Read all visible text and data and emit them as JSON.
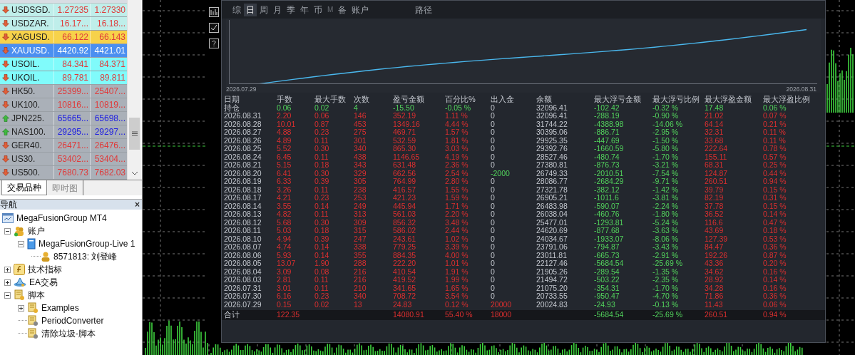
{
  "market_watch": {
    "rows": [
      {
        "symbol": "USDSGD.",
        "bid": "1.27235",
        "ask": "1.27330",
        "rising": false,
        "color": "#bfeeea",
        "selected": false
      },
      {
        "symbol": "USDZAR.",
        "bid": "16.17...",
        "ask": "16.18...",
        "rising": false,
        "color": "#bfeeea",
        "selected": false
      },
      {
        "symbol": "XAGUSD.",
        "bid": "66.122",
        "ask": "66.143",
        "rising": false,
        "color": "#f7d24a",
        "selected": false
      },
      {
        "symbol": "XAUUSD.",
        "bid": "4420.92",
        "ask": "4421.01",
        "rising": false,
        "color": "#4b8ff0",
        "selected": true
      },
      {
        "symbol": "USOIL.",
        "bid": "84.341",
        "ask": "84.371",
        "rising": false,
        "color": "#80fbfb",
        "selected": false
      },
      {
        "symbol": "UKOIL.",
        "bid": "89.781",
        "ask": "89.811",
        "rising": false,
        "color": "#80fbfb",
        "selected": false
      },
      {
        "symbol": "HK50.",
        "bid": "25399...",
        "ask": "25407...",
        "rising": false,
        "color": "#aab0b8",
        "selected": false
      },
      {
        "symbol": "UK100.",
        "bid": "10816...",
        "ask": "10819...",
        "rising": false,
        "color": "#aab0b8",
        "selected": false
      },
      {
        "symbol": "JPN225.",
        "bid": "65665...",
        "ask": "65698...",
        "rising": true,
        "color": "#aab0b8",
        "selected": false
      },
      {
        "symbol": "NAS100.",
        "bid": "29295...",
        "ask": "29297...",
        "rising": true,
        "color": "#aab0b8",
        "selected": false
      },
      {
        "symbol": "GER40.",
        "bid": "26471...",
        "ask": "26476...",
        "rising": false,
        "color": "#aab0b8",
        "selected": false
      },
      {
        "symbol": "US30.",
        "bid": "53402...",
        "ask": "53404...",
        "rising": false,
        "color": "#aab0b8",
        "selected": false
      },
      {
        "symbol": "US500.",
        "bid": "7680.73",
        "ask": "7682.03",
        "rising": false,
        "color": "#aab0b8",
        "selected": false
      }
    ],
    "tabs": [
      {
        "label": "交易品种",
        "selected": true
      },
      {
        "label": "即时图",
        "selected": false
      }
    ]
  },
  "navigator": {
    "title": "导航",
    "close": "×",
    "tree": [
      {
        "label": "MegaFusionGroup MT4",
        "kind": "terminal",
        "children": [
          {
            "label": "账户",
            "kind": "accounts",
            "expanded": true,
            "children": [
              {
                "label": "MegaFusionGroup-Live 1",
                "kind": "server",
                "expanded": true,
                "children": [
                  {
                    "label": "8571813: 刘登峰",
                    "kind": "user"
                  }
                ]
              }
            ]
          },
          {
            "label": "技术指标",
            "kind": "indicators",
            "expanded": false
          },
          {
            "label": "EA交易",
            "kind": "experts",
            "expanded": false
          },
          {
            "label": "脚本",
            "kind": "scripts",
            "expanded": true,
            "children": [
              {
                "label": "Examples",
                "kind": "scripts",
                "expanded": false
              },
              {
                "label": "PeriodConverter",
                "kind": "script"
              },
              {
                "label": "清除垃圾-脚本",
                "kind": "script"
              }
            ]
          }
        ]
      }
    ]
  },
  "report": {
    "tabs": [
      {
        "label": "综",
        "selected": false,
        "disabled": false
      },
      {
        "label": "日",
        "selected": true,
        "disabled": false
      },
      {
        "label": "周",
        "selected": false,
        "disabled": false
      },
      {
        "label": "月",
        "selected": false,
        "disabled": false
      },
      {
        "label": "季",
        "selected": false,
        "disabled": false
      },
      {
        "label": "年",
        "selected": false,
        "disabled": false
      },
      {
        "label": "币",
        "selected": false,
        "disabled": false
      },
      {
        "label": "M",
        "selected": false,
        "disabled": true
      },
      {
        "label": "备",
        "selected": false,
        "disabled": false
      },
      {
        "label": "账户",
        "selected": false,
        "disabled": false
      },
      {
        "label": "路径",
        "selected": false,
        "disabled": false
      }
    ],
    "chart": {
      "start_label": "2026.07.29",
      "end_label": "2026.08.31"
    },
    "columns": [
      "日期",
      "手数",
      "最大手数",
      "次数",
      "盈亏金额",
      "百分比%",
      "出入金",
      "余额",
      "最大浮亏金额",
      "最大浮亏比例",
      "最大浮盈金额",
      "最大浮盈比例"
    ],
    "rows": [
      {
        "kind": "open",
        "cells": [
          "持仓",
          "0.06",
          "0.02",
          "4",
          "-15.50",
          "-0.05 %",
          "0",
          "32096.41",
          "-102.42",
          "-0.32 %",
          "17.48",
          "0.06 %"
        ]
      },
      {
        "kind": "day",
        "cells": [
          "2026.08.31",
          "2.20",
          "0.06",
          "146",
          "352.19",
          "1.11 %",
          "0",
          "32096.41",
          "-288.19",
          "-0.90 %",
          "21.02",
          "0.07 %"
        ]
      },
      {
        "kind": "day",
        "cells": [
          "2026.08.28",
          "10.01",
          "0.87",
          "453",
          "1349.16",
          "4.44 %",
          "0",
          "31744.22",
          "-4388.98",
          "-14.06 %",
          "64.14",
          "0.21 %"
        ]
      },
      {
        "kind": "day",
        "cells": [
          "2026.08.27",
          "4.88",
          "0.23",
          "275",
          "469.71",
          "1.57 %",
          "0",
          "30395.06",
          "-886.71",
          "-2.95 %",
          "32.31",
          "0.11 %"
        ]
      },
      {
        "kind": "day",
        "cells": [
          "2026.08.26",
          "4.89",
          "0.11",
          "301",
          "532.59",
          "1.81 %",
          "0",
          "29925.35",
          "-447.69",
          "-1.50 %",
          "33.68",
          "0.11 %"
        ]
      },
      {
        "kind": "day",
        "cells": [
          "2026.08.25",
          "5.52",
          "0.30",
          "340",
          "865.30",
          "3.03 %",
          "0",
          "29392.76",
          "-1660.59",
          "-5.80 %",
          "222.64",
          "0.78 %"
        ]
      },
      {
        "kind": "day",
        "cells": [
          "2026.08.24",
          "6.45",
          "0.11",
          "438",
          "1146.65",
          "4.19 %",
          "0",
          "28527.46",
          "-480.74",
          "-1.70 %",
          "155.11",
          "0.57 %"
        ]
      },
      {
        "kind": "day",
        "cells": [
          "2026.08.21",
          "5.15",
          "0.18",
          "343",
          "631.48",
          "2.36 %",
          "0",
          "27380.81",
          "-876.73",
          "-3.21 %",
          "68.31",
          "0.25 %"
        ]
      },
      {
        "kind": "withdrawal",
        "cells": [
          "2026.08.20",
          "6.41",
          "0.30",
          "329",
          "662.56",
          "2.54 %",
          "-2000",
          "26749.33",
          "-2010.51",
          "-7.54 %",
          "124.87",
          "0.44 %"
        ]
      },
      {
        "kind": "day",
        "cells": [
          "2026.08.19",
          "6.33",
          "0.39",
          "305",
          "764.99",
          "2.80 %",
          "0",
          "28086.77",
          "-2684.29",
          "-9.71 %",
          "260.51",
          "0.94 %"
        ]
      },
      {
        "kind": "day",
        "cells": [
          "2026.08.18",
          "3.26",
          "0.11",
          "238",
          "416.57",
          "1.55 %",
          "0",
          "27321.78",
          "-382.12",
          "-1.42 %",
          "39.79",
          "0.15 %"
        ]
      },
      {
        "kind": "day",
        "cells": [
          "2026.08.17",
          "4.21",
          "0.23",
          "253",
          "421.23",
          "1.59 %",
          "0",
          "26905.21",
          "-1011.6",
          "-3.81 %",
          "82.19",
          "0.31 %"
        ]
      },
      {
        "kind": "day",
        "cells": [
          "2026.08.14",
          "3.55",
          "0.14",
          "249",
          "445.94",
          "1.71 %",
          "0",
          "26483.98",
          "-590.07",
          "-2.24 %",
          "37.78",
          "0.15 %"
        ]
      },
      {
        "kind": "day",
        "cells": [
          "2026.08.13",
          "4.82",
          "0.11",
          "313",
          "561.03",
          "2.20 %",
          "0",
          "26038.04",
          "-460.76",
          "-1.80 %",
          "36.52",
          "0.14 %"
        ]
      },
      {
        "kind": "day",
        "cells": [
          "2026.08.12",
          "5.68",
          "0.30",
          "309",
          "856.32",
          "3.48 %",
          "0",
          "25477.01",
          "-1293.81",
          "-5.24 %",
          "116.6",
          "0.47 %"
        ]
      },
      {
        "kind": "day",
        "cells": [
          "2026.08.11",
          "5.03",
          "0.18",
          "315",
          "586.02",
          "2.44 %",
          "0",
          "24620.69",
          "-877.68",
          "-3.63 %",
          "43.69",
          "0.18 %"
        ]
      },
      {
        "kind": "day",
        "cells": [
          "2026.08.10",
          "4.94",
          "0.39",
          "247",
          "243.61",
          "1.02 %",
          "0",
          "24034.67",
          "-1933.07",
          "-8.06 %",
          "127.39",
          "0.53 %"
        ]
      },
      {
        "kind": "day",
        "cells": [
          "2026.08.07",
          "4.74",
          "0.14",
          "338",
          "779.25",
          "3.39 %",
          "0",
          "23791.06",
          "-794.87",
          "-3.43 %",
          "84.47",
          "0.36 %"
        ]
      },
      {
        "kind": "day",
        "cells": [
          "2026.08.06",
          "5.93",
          "0.14",
          "355",
          "884.35",
          "4.00 %",
          "0",
          "23011.81",
          "-665.73",
          "-2.91 %",
          "192.26",
          "0.87 %"
        ]
      },
      {
        "kind": "day",
        "cells": [
          "2026.08.05",
          "13.07",
          "1.90",
          "288",
          "222.20",
          "1.01 %",
          "0",
          "22127.46",
          "-5684.54",
          "-25.69 %",
          "43.36",
          "0.20 %"
        ]
      },
      {
        "kind": "day",
        "cells": [
          "2026.08.04",
          "3.09",
          "0.08",
          "216",
          "410.54",
          "1.91 %",
          "0",
          "21905.26",
          "-289.54",
          "-1.35 %",
          "34.62",
          "0.16 %"
        ]
      },
      {
        "kind": "day",
        "cells": [
          "2026.08.03",
          "2.81",
          "0.11",
          "216",
          "419.52",
          "1.99 %",
          "0",
          "21494.72",
          "-503.22",
          "-2.35 %",
          "28.92",
          "0.14 %"
        ]
      },
      {
        "kind": "day",
        "cells": [
          "2026.07.31",
          "3.01",
          "0.11",
          "210",
          "341.65",
          "1.65 %",
          "0",
          "21075.20",
          "-354.31",
          "-1.70 %",
          "34.28",
          "0.16 %"
        ]
      },
      {
        "kind": "day",
        "cells": [
          "2026.07.30",
          "6.16",
          "0.23",
          "340",
          "708.72",
          "3.54 %",
          "0",
          "20733.55",
          "-950.47",
          "-4.70 %",
          "71.86",
          "0.36 %"
        ]
      },
      {
        "kind": "deposit",
        "cells": [
          "2026.07.29",
          "0.15",
          "0.02",
          "13",
          "24.83",
          "0.12 %",
          "20000",
          "20024.83",
          "-24.93",
          "-0.13 %",
          "11.43",
          "0.06 %"
        ]
      },
      {
        "kind": "total",
        "cells": [
          "合计",
          "122.35",
          null,
          null,
          "14080.91",
          "55.40 %",
          "18000",
          null,
          "-5684.54",
          "-25.69 %",
          "260.51",
          "0.94 %"
        ]
      }
    ]
  }
}
